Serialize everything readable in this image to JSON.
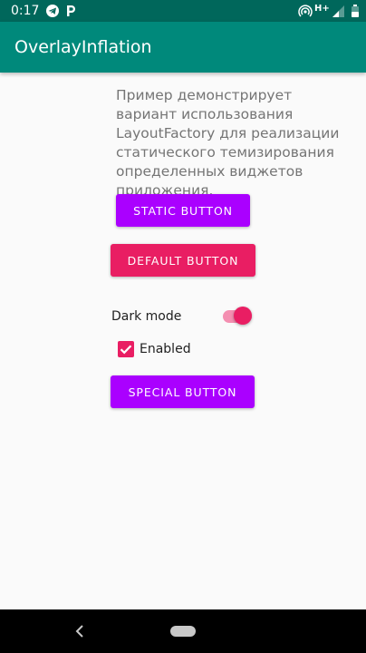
{
  "status_bar": {
    "time": "0:17",
    "network": "H+",
    "icons": [
      "telegram-icon",
      "parking-icon",
      "hotspot-icon",
      "signal-icon",
      "battery-icon"
    ]
  },
  "app_bar": {
    "title": "OverlayInflation",
    "color": "#00897b",
    "status_color": "#00675b"
  },
  "main": {
    "description": "Пример демонстрирует вариант использования LayoutFactory для реализации статического темизирования определенных виджетов приложения.",
    "static_button_label": "Static button",
    "default_button_label": "Default button",
    "dark_mode_label": "Dark mode",
    "dark_mode_on": true,
    "enabled_label": "Enabled",
    "enabled_checked": true,
    "special_button_label": "Special button"
  },
  "colors": {
    "purple_button": "#aa00ff",
    "pink_accent": "#e91e63"
  },
  "nav_bar": {
    "icons": [
      "back-icon",
      "home-pill-icon"
    ]
  }
}
